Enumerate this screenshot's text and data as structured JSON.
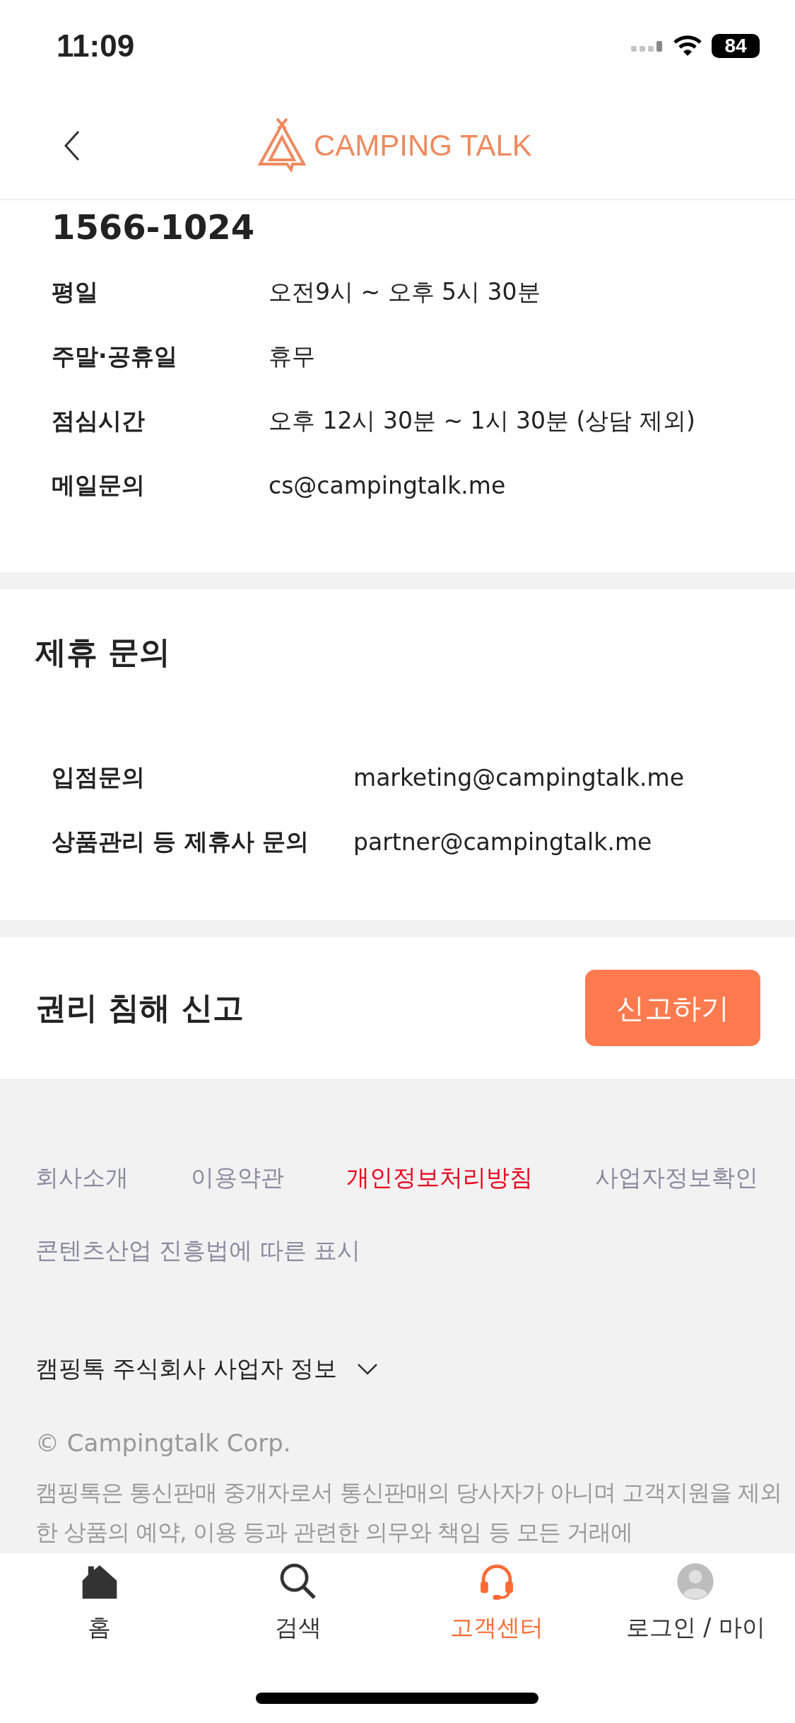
{
  "status_bar": {
    "time": "11:09",
    "battery": "84"
  },
  "header": {
    "logo_text": "CAMPING TALK"
  },
  "contact": {
    "phone": "1566-1024",
    "rows": [
      {
        "label": "평일",
        "value": "오전9시 ~ 오후 5시 30분"
      },
      {
        "label": "주말·공휴일",
        "value": "휴무"
      },
      {
        "label": "점심시간",
        "value": "오후 12시 30분 ~ 1시 30분 (상담 제외)"
      },
      {
        "label": "메일문의",
        "value": "cs@campingtalk.me"
      }
    ]
  },
  "partnership": {
    "title": "제휴 문의",
    "rows": [
      {
        "label": "입점문의",
        "value": "marketing@campingtalk.me"
      },
      {
        "label": "상품관리 등 제휴사 문의",
        "value": "partner@campingtalk.me"
      }
    ]
  },
  "report": {
    "title": "권리 침해 신고",
    "button": "신고하기"
  },
  "footer": {
    "links": [
      {
        "label": "회사소개",
        "highlighted": false
      },
      {
        "label": "이용약관",
        "highlighted": false
      },
      {
        "label": "개인정보처리방침",
        "highlighted": true
      },
      {
        "label": "사업자정보확인",
        "highlighted": false
      },
      {
        "label": "콘텐츠산업 진흥법에 따른 표시",
        "highlighted": false
      }
    ],
    "business_info": {
      "label": "캠핑톡 주식회사 사업자 정보",
      "expanded": false
    },
    "copyright": "© Campingtalk Corp.",
    "notice": "캠핑톡은 통신판매 중개자로서 통신판매의 당사자가 아니며 고객지원을 제외한 상품의 예약, 이용 등과 관련한 의무와 책임 등 모든 거래에"
  },
  "tab_bar": [
    {
      "label": "홈",
      "selected": false
    },
    {
      "label": "검색",
      "selected": false
    },
    {
      "label": "고객센터",
      "selected": true
    },
    {
      "label": "로그인 / 마이",
      "selected": false
    }
  ]
}
